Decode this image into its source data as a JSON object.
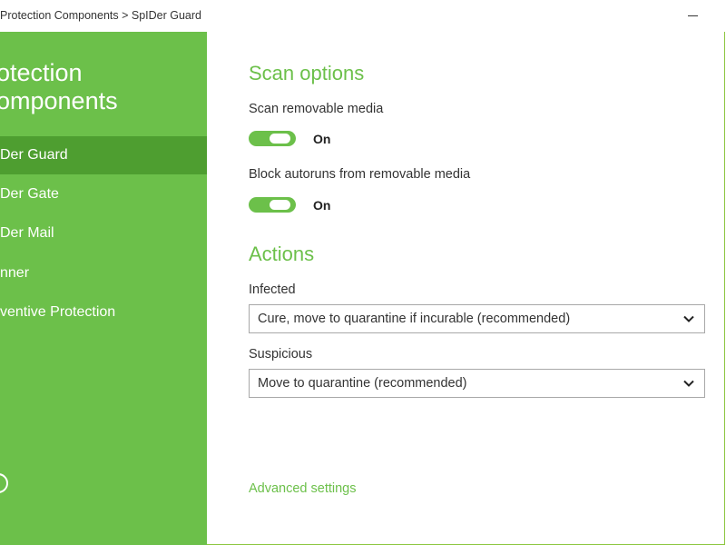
{
  "window": {
    "breadcrumb": "Protection Components > SpIDer Guard"
  },
  "sidebar": {
    "heading_line1": "otection",
    "heading_line2": "omponents",
    "items": [
      {
        "label": "Der Guard",
        "active": true
      },
      {
        "label": "Der Gate",
        "active": false
      },
      {
        "label": "Der Mail",
        "active": false
      },
      {
        "label": "nner",
        "active": false
      },
      {
        "label": "ventive Protection",
        "active": false
      }
    ]
  },
  "main": {
    "scan_options_title": "Scan options",
    "scan_removable": {
      "label": "Scan removable media",
      "state": "On"
    },
    "block_autoruns": {
      "label": "Block autoruns from removable media",
      "state": "On"
    },
    "actions_title": "Actions",
    "infected": {
      "label": "Infected",
      "value": "Cure, move to quarantine if incurable (recommended)"
    },
    "suspicious": {
      "label": "Suspicious",
      "value": "Move to quarantine (recommended)"
    },
    "advanced_settings": "Advanced settings"
  },
  "colors": {
    "accent": "#6cc04a",
    "sidebar_active": "#4e9e30"
  },
  "icons": {
    "minimize": "minimize-icon",
    "chevron": "chevron-down-icon",
    "help": "help-icon"
  }
}
